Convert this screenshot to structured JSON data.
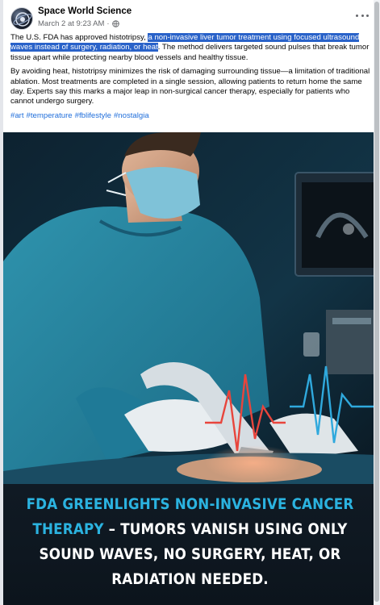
{
  "post": {
    "page_name": "Space World Science",
    "timestamp": "March 2 at 9:23 AM",
    "separator": "·",
    "text_p1_before": "The U.S. FDA has approved histotripsy, ",
    "text_p1_highlight": "a non-invasive liver tumor treatment using focused ultrasound waves instead of surgery, radiation, or heat",
    "text_p1_after": ". The method delivers targeted sound pulses that break tumor tissue apart while protecting nearby blood vessels and healthy tissue.",
    "text_p2": "By avoiding heat, histotripsy minimizes the risk of damaging surrounding tissue—a limitation of traditional ablation. Most treatments are completed in a single session, allowing patients to return home the same day. Experts say this marks a major leap in non-surgical cancer therapy, especially for patients who cannot undergo surgery.",
    "hashtags": [
      "#art",
      "#temperature",
      "#fblifestyle",
      "#nostalgia"
    ]
  },
  "image": {
    "caption_accent_1": "FDA GREENLIGHTS NON-INVASIVE CANCER",
    "caption_accent_2": "THERAPY",
    "caption_rest_2": " – TUMORS VANISH USING ONLY",
    "caption_line_3": "SOUND WAVES, NO SURGERY, HEAT, OR",
    "caption_line_4": "RADIATION NEEDED."
  },
  "icons": {
    "more": "more-options-icon",
    "privacy": "globe-icon"
  },
  "colors": {
    "highlight": "#2962c9",
    "link": "#216fdb",
    "caption_accent": "#2bb3e0"
  }
}
